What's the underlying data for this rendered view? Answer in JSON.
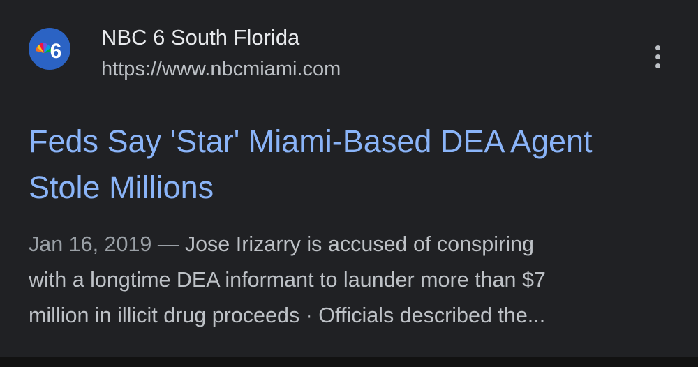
{
  "result": {
    "source_name": "NBC 6 South Florida",
    "source_url": "https://www.nbcmiami.com",
    "favicon": "nbc-peacock-6-logo",
    "more_icon": "more-vert-icon",
    "title_line1": "Feds Say 'Star' Miami-Based DEA Agent",
    "title_line2": "Stole Millions",
    "date": "Jan 16, 2019 —",
    "snippet_line1": "Jose Irizarry is accused of conspiring",
    "snippet_line2": "with a longtime DEA informant to launder more than $7",
    "snippet_line3": "million in illicit drug proceeds · Officials described the..."
  },
  "colors": {
    "background": "#202124",
    "title_link": "#8ab4f8",
    "primary_text": "#e8eaed",
    "secondary_text": "#bdc1c6",
    "favicon_bg": "#2b63c4"
  }
}
